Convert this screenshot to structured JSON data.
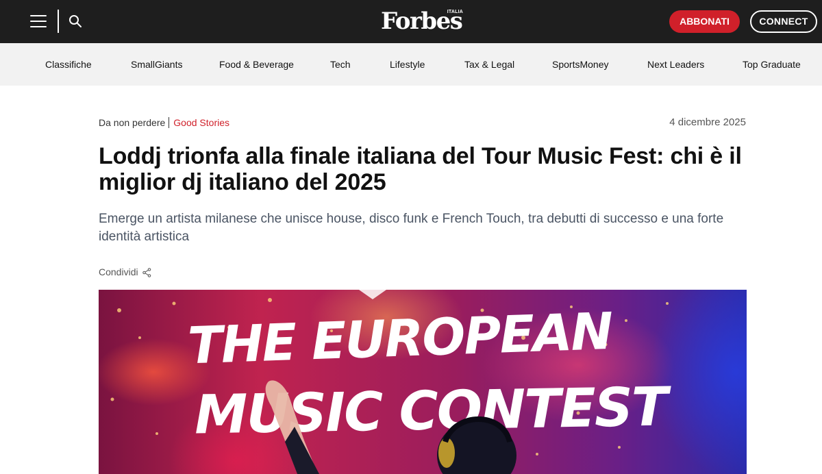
{
  "header": {
    "logo_text": "Forbes",
    "logo_sub": "ITALIA",
    "subscribe_label": "ABBONATI",
    "connect_label": "CONNECT"
  },
  "nav": {
    "items": [
      {
        "label": "Classifiche"
      },
      {
        "label": "SmallGiants"
      },
      {
        "label": "Food & Beverage"
      },
      {
        "label": "Tech"
      },
      {
        "label": "Lifestyle"
      },
      {
        "label": "Tax & Legal"
      },
      {
        "label": "SportsMoney"
      },
      {
        "label": "Next Leaders"
      },
      {
        "label": "Top Graduate"
      }
    ]
  },
  "article": {
    "kicker": "Da non perdere",
    "category": "Good Stories",
    "date": "4 dicembre 2025",
    "headline": "Loddj trionfa alla finale italiana del Tour Music Fest: chi è il miglior dj italiano del 2025",
    "subtitle": "Emerge un artista milanese che unisce house, disco funk e French Touch, tra debutti di successo e una forte identità artistica",
    "share_label": "Condividi"
  },
  "hero": {
    "line1": "THE EUROPEAN",
    "line2": "MUSIC CONTEST"
  },
  "icons": {
    "menu": "hamburger-icon",
    "search": "search-icon",
    "share": "share-icon"
  },
  "colors": {
    "topbar": "#1e1e1e",
    "accent": "#d0202a",
    "nav_bg": "#f2f2f2"
  }
}
